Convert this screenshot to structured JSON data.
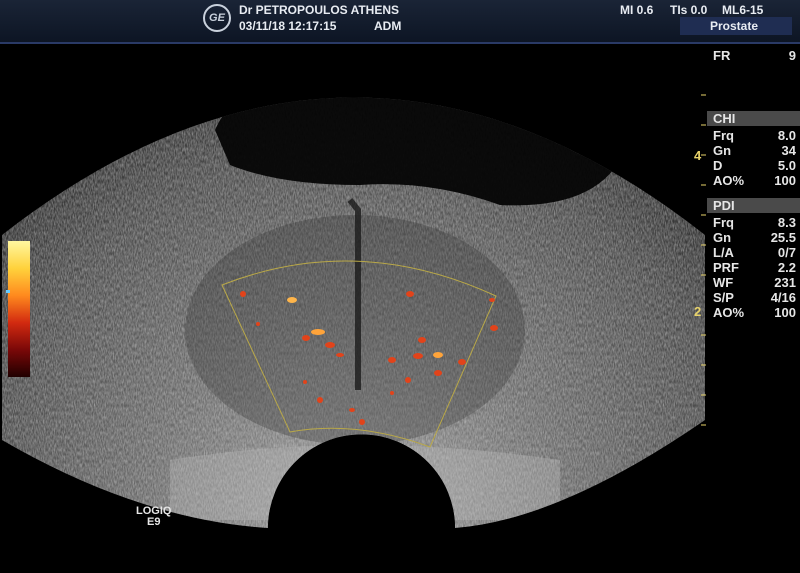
{
  "header": {
    "clinic": "Dr PETROPOULOS ATHENS",
    "datetime": "03/11/18 12:17:15",
    "operator": "ADM",
    "mi": "MI 0.6",
    "tis": "TIs 0.0",
    "probe": "ML6-15",
    "preset": "Prostate",
    "logo": "GE"
  },
  "params": {
    "fr": {
      "label": "FR",
      "value": "9"
    },
    "chi_title": "CHI",
    "chi": [
      {
        "label": "Frq",
        "value": "8.0"
      },
      {
        "label": "Gn",
        "value": "34"
      },
      {
        "label": "D",
        "value": "5.0"
      },
      {
        "label": "AO%",
        "value": "100"
      }
    ],
    "pdi_title": "PDI",
    "pdi": [
      {
        "label": "Frq",
        "value": "8.3"
      },
      {
        "label": "Gn",
        "value": "25.5"
      },
      {
        "label": "L/A",
        "value": "0/7"
      },
      {
        "label": "PRF",
        "value": "2.2"
      },
      {
        "label": "WF",
        "value": "231"
      },
      {
        "label": "S/P",
        "value": "4/16"
      },
      {
        "label": "AO%",
        "value": "100"
      }
    ]
  },
  "depth_markers": [
    "4",
    "2"
  ],
  "model": {
    "line1": "LOGIQ",
    "line2": "E9"
  },
  "colors": {
    "accent": "#e8d36a",
    "panel_bg": "#4a4a4a",
    "topbar": "#1a2436"
  }
}
